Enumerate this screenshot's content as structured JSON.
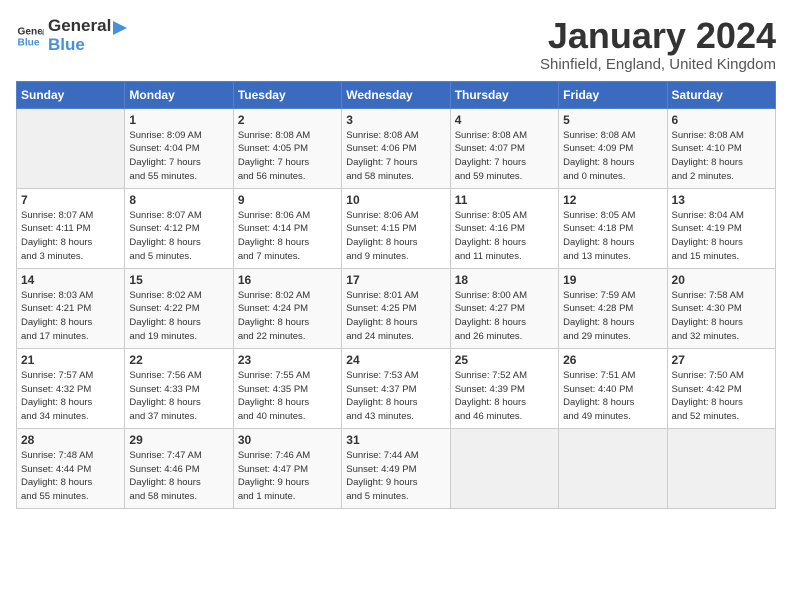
{
  "header": {
    "logo_general": "General",
    "logo_blue": "Blue",
    "month_title": "January 2024",
    "subtitle": "Shinfield, England, United Kingdom"
  },
  "weekdays": [
    "Sunday",
    "Monday",
    "Tuesday",
    "Wednesday",
    "Thursday",
    "Friday",
    "Saturday"
  ],
  "weeks": [
    [
      {
        "day": "",
        "info": ""
      },
      {
        "day": "1",
        "info": "Sunrise: 8:09 AM\nSunset: 4:04 PM\nDaylight: 7 hours\nand 55 minutes."
      },
      {
        "day": "2",
        "info": "Sunrise: 8:08 AM\nSunset: 4:05 PM\nDaylight: 7 hours\nand 56 minutes."
      },
      {
        "day": "3",
        "info": "Sunrise: 8:08 AM\nSunset: 4:06 PM\nDaylight: 7 hours\nand 58 minutes."
      },
      {
        "day": "4",
        "info": "Sunrise: 8:08 AM\nSunset: 4:07 PM\nDaylight: 7 hours\nand 59 minutes."
      },
      {
        "day": "5",
        "info": "Sunrise: 8:08 AM\nSunset: 4:09 PM\nDaylight: 8 hours\nand 0 minutes."
      },
      {
        "day": "6",
        "info": "Sunrise: 8:08 AM\nSunset: 4:10 PM\nDaylight: 8 hours\nand 2 minutes."
      }
    ],
    [
      {
        "day": "7",
        "info": "Sunrise: 8:07 AM\nSunset: 4:11 PM\nDaylight: 8 hours\nand 3 minutes."
      },
      {
        "day": "8",
        "info": "Sunrise: 8:07 AM\nSunset: 4:12 PM\nDaylight: 8 hours\nand 5 minutes."
      },
      {
        "day": "9",
        "info": "Sunrise: 8:06 AM\nSunset: 4:14 PM\nDaylight: 8 hours\nand 7 minutes."
      },
      {
        "day": "10",
        "info": "Sunrise: 8:06 AM\nSunset: 4:15 PM\nDaylight: 8 hours\nand 9 minutes."
      },
      {
        "day": "11",
        "info": "Sunrise: 8:05 AM\nSunset: 4:16 PM\nDaylight: 8 hours\nand 11 minutes."
      },
      {
        "day": "12",
        "info": "Sunrise: 8:05 AM\nSunset: 4:18 PM\nDaylight: 8 hours\nand 13 minutes."
      },
      {
        "day": "13",
        "info": "Sunrise: 8:04 AM\nSunset: 4:19 PM\nDaylight: 8 hours\nand 15 minutes."
      }
    ],
    [
      {
        "day": "14",
        "info": "Sunrise: 8:03 AM\nSunset: 4:21 PM\nDaylight: 8 hours\nand 17 minutes."
      },
      {
        "day": "15",
        "info": "Sunrise: 8:02 AM\nSunset: 4:22 PM\nDaylight: 8 hours\nand 19 minutes."
      },
      {
        "day": "16",
        "info": "Sunrise: 8:02 AM\nSunset: 4:24 PM\nDaylight: 8 hours\nand 22 minutes."
      },
      {
        "day": "17",
        "info": "Sunrise: 8:01 AM\nSunset: 4:25 PM\nDaylight: 8 hours\nand 24 minutes."
      },
      {
        "day": "18",
        "info": "Sunrise: 8:00 AM\nSunset: 4:27 PM\nDaylight: 8 hours\nand 26 minutes."
      },
      {
        "day": "19",
        "info": "Sunrise: 7:59 AM\nSunset: 4:28 PM\nDaylight: 8 hours\nand 29 minutes."
      },
      {
        "day": "20",
        "info": "Sunrise: 7:58 AM\nSunset: 4:30 PM\nDaylight: 8 hours\nand 32 minutes."
      }
    ],
    [
      {
        "day": "21",
        "info": "Sunrise: 7:57 AM\nSunset: 4:32 PM\nDaylight: 8 hours\nand 34 minutes."
      },
      {
        "day": "22",
        "info": "Sunrise: 7:56 AM\nSunset: 4:33 PM\nDaylight: 8 hours\nand 37 minutes."
      },
      {
        "day": "23",
        "info": "Sunrise: 7:55 AM\nSunset: 4:35 PM\nDaylight: 8 hours\nand 40 minutes."
      },
      {
        "day": "24",
        "info": "Sunrise: 7:53 AM\nSunset: 4:37 PM\nDaylight: 8 hours\nand 43 minutes."
      },
      {
        "day": "25",
        "info": "Sunrise: 7:52 AM\nSunset: 4:39 PM\nDaylight: 8 hours\nand 46 minutes."
      },
      {
        "day": "26",
        "info": "Sunrise: 7:51 AM\nSunset: 4:40 PM\nDaylight: 8 hours\nand 49 minutes."
      },
      {
        "day": "27",
        "info": "Sunrise: 7:50 AM\nSunset: 4:42 PM\nDaylight: 8 hours\nand 52 minutes."
      }
    ],
    [
      {
        "day": "28",
        "info": "Sunrise: 7:48 AM\nSunset: 4:44 PM\nDaylight: 8 hours\nand 55 minutes."
      },
      {
        "day": "29",
        "info": "Sunrise: 7:47 AM\nSunset: 4:46 PM\nDaylight: 8 hours\nand 58 minutes."
      },
      {
        "day": "30",
        "info": "Sunrise: 7:46 AM\nSunset: 4:47 PM\nDaylight: 9 hours\nand 1 minute."
      },
      {
        "day": "31",
        "info": "Sunrise: 7:44 AM\nSunset: 4:49 PM\nDaylight: 9 hours\nand 5 minutes."
      },
      {
        "day": "",
        "info": ""
      },
      {
        "day": "",
        "info": ""
      },
      {
        "day": "",
        "info": ""
      }
    ]
  ]
}
